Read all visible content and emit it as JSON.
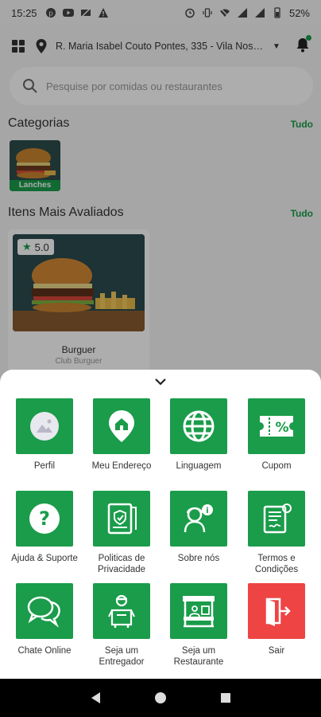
{
  "status_bar": {
    "time": "15:25",
    "battery": "52%"
  },
  "header": {
    "address": "R. Maria Isabel Couto Pontes, 335 - Vila Nossa Sr..."
  },
  "search": {
    "placeholder": "Pesquise por comidas ou restaurantes"
  },
  "categories": {
    "title": "Categorias",
    "see_all": "Tudo",
    "items": [
      {
        "label": "Lanches"
      }
    ]
  },
  "top_items": {
    "title": "Itens Mais Avaliados",
    "see_all": "Tudo",
    "items": [
      {
        "rating": "5.0",
        "name": "Burguer",
        "restaurant": "Club Burguer"
      }
    ]
  },
  "menu": {
    "items": [
      {
        "label": "Perfil",
        "icon": "profile-image-icon"
      },
      {
        "label": "Meu Endereço",
        "icon": "home-pin-icon"
      },
      {
        "label": "Linguagem",
        "icon": "globe-icon"
      },
      {
        "label": "Cupom",
        "icon": "coupon-icon"
      },
      {
        "label": "Ajuda & Suporte",
        "icon": "help-icon"
      },
      {
        "label": "Politicas de Privacidade",
        "icon": "privacy-policy-icon"
      },
      {
        "label": "Sobre nós",
        "icon": "about-us-icon"
      },
      {
        "label": "Termos e Condições",
        "icon": "terms-icon"
      },
      {
        "label": "Chate Online",
        "icon": "chat-icon"
      },
      {
        "label": "Seja um Entregador",
        "icon": "delivery-man-icon"
      },
      {
        "label": "Seja um Restaurante",
        "icon": "restaurant-stall-icon"
      },
      {
        "label": "Sair",
        "icon": "logout-icon"
      }
    ]
  },
  "colors": {
    "accent": "#1a9c4a",
    "danger": "#ef4444"
  }
}
